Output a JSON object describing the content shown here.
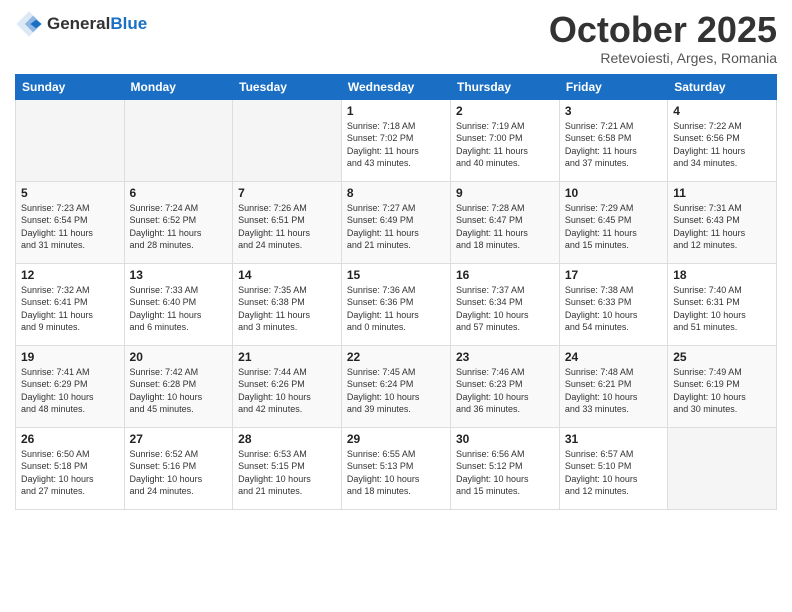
{
  "header": {
    "logo_general": "General",
    "logo_blue": "Blue",
    "month_title": "October 2025",
    "subtitle": "Retevoiesti, Arges, Romania"
  },
  "calendar": {
    "days_of_week": [
      "Sunday",
      "Monday",
      "Tuesday",
      "Wednesday",
      "Thursday",
      "Friday",
      "Saturday"
    ],
    "weeks": [
      [
        {
          "day": "",
          "info": ""
        },
        {
          "day": "",
          "info": ""
        },
        {
          "day": "",
          "info": ""
        },
        {
          "day": "1",
          "info": "Sunrise: 7:18 AM\nSunset: 7:02 PM\nDaylight: 11 hours\nand 43 minutes."
        },
        {
          "day": "2",
          "info": "Sunrise: 7:19 AM\nSunset: 7:00 PM\nDaylight: 11 hours\nand 40 minutes."
        },
        {
          "day": "3",
          "info": "Sunrise: 7:21 AM\nSunset: 6:58 PM\nDaylight: 11 hours\nand 37 minutes."
        },
        {
          "day": "4",
          "info": "Sunrise: 7:22 AM\nSunset: 6:56 PM\nDaylight: 11 hours\nand 34 minutes."
        }
      ],
      [
        {
          "day": "5",
          "info": "Sunrise: 7:23 AM\nSunset: 6:54 PM\nDaylight: 11 hours\nand 31 minutes."
        },
        {
          "day": "6",
          "info": "Sunrise: 7:24 AM\nSunset: 6:52 PM\nDaylight: 11 hours\nand 28 minutes."
        },
        {
          "day": "7",
          "info": "Sunrise: 7:26 AM\nSunset: 6:51 PM\nDaylight: 11 hours\nand 24 minutes."
        },
        {
          "day": "8",
          "info": "Sunrise: 7:27 AM\nSunset: 6:49 PM\nDaylight: 11 hours\nand 21 minutes."
        },
        {
          "day": "9",
          "info": "Sunrise: 7:28 AM\nSunset: 6:47 PM\nDaylight: 11 hours\nand 18 minutes."
        },
        {
          "day": "10",
          "info": "Sunrise: 7:29 AM\nSunset: 6:45 PM\nDaylight: 11 hours\nand 15 minutes."
        },
        {
          "day": "11",
          "info": "Sunrise: 7:31 AM\nSunset: 6:43 PM\nDaylight: 11 hours\nand 12 minutes."
        }
      ],
      [
        {
          "day": "12",
          "info": "Sunrise: 7:32 AM\nSunset: 6:41 PM\nDaylight: 11 hours\nand 9 minutes."
        },
        {
          "day": "13",
          "info": "Sunrise: 7:33 AM\nSunset: 6:40 PM\nDaylight: 11 hours\nand 6 minutes."
        },
        {
          "day": "14",
          "info": "Sunrise: 7:35 AM\nSunset: 6:38 PM\nDaylight: 11 hours\nand 3 minutes."
        },
        {
          "day": "15",
          "info": "Sunrise: 7:36 AM\nSunset: 6:36 PM\nDaylight: 11 hours\nand 0 minutes."
        },
        {
          "day": "16",
          "info": "Sunrise: 7:37 AM\nSunset: 6:34 PM\nDaylight: 10 hours\nand 57 minutes."
        },
        {
          "day": "17",
          "info": "Sunrise: 7:38 AM\nSunset: 6:33 PM\nDaylight: 10 hours\nand 54 minutes."
        },
        {
          "day": "18",
          "info": "Sunrise: 7:40 AM\nSunset: 6:31 PM\nDaylight: 10 hours\nand 51 minutes."
        }
      ],
      [
        {
          "day": "19",
          "info": "Sunrise: 7:41 AM\nSunset: 6:29 PM\nDaylight: 10 hours\nand 48 minutes."
        },
        {
          "day": "20",
          "info": "Sunrise: 7:42 AM\nSunset: 6:28 PM\nDaylight: 10 hours\nand 45 minutes."
        },
        {
          "day": "21",
          "info": "Sunrise: 7:44 AM\nSunset: 6:26 PM\nDaylight: 10 hours\nand 42 minutes."
        },
        {
          "day": "22",
          "info": "Sunrise: 7:45 AM\nSunset: 6:24 PM\nDaylight: 10 hours\nand 39 minutes."
        },
        {
          "day": "23",
          "info": "Sunrise: 7:46 AM\nSunset: 6:23 PM\nDaylight: 10 hours\nand 36 minutes."
        },
        {
          "day": "24",
          "info": "Sunrise: 7:48 AM\nSunset: 6:21 PM\nDaylight: 10 hours\nand 33 minutes."
        },
        {
          "day": "25",
          "info": "Sunrise: 7:49 AM\nSunset: 6:19 PM\nDaylight: 10 hours\nand 30 minutes."
        }
      ],
      [
        {
          "day": "26",
          "info": "Sunrise: 6:50 AM\nSunset: 5:18 PM\nDaylight: 10 hours\nand 27 minutes."
        },
        {
          "day": "27",
          "info": "Sunrise: 6:52 AM\nSunset: 5:16 PM\nDaylight: 10 hours\nand 24 minutes."
        },
        {
          "day": "28",
          "info": "Sunrise: 6:53 AM\nSunset: 5:15 PM\nDaylight: 10 hours\nand 21 minutes."
        },
        {
          "day": "29",
          "info": "Sunrise: 6:55 AM\nSunset: 5:13 PM\nDaylight: 10 hours\nand 18 minutes."
        },
        {
          "day": "30",
          "info": "Sunrise: 6:56 AM\nSunset: 5:12 PM\nDaylight: 10 hours\nand 15 minutes."
        },
        {
          "day": "31",
          "info": "Sunrise: 6:57 AM\nSunset: 5:10 PM\nDaylight: 10 hours\nand 12 minutes."
        },
        {
          "day": "",
          "info": ""
        }
      ]
    ]
  }
}
